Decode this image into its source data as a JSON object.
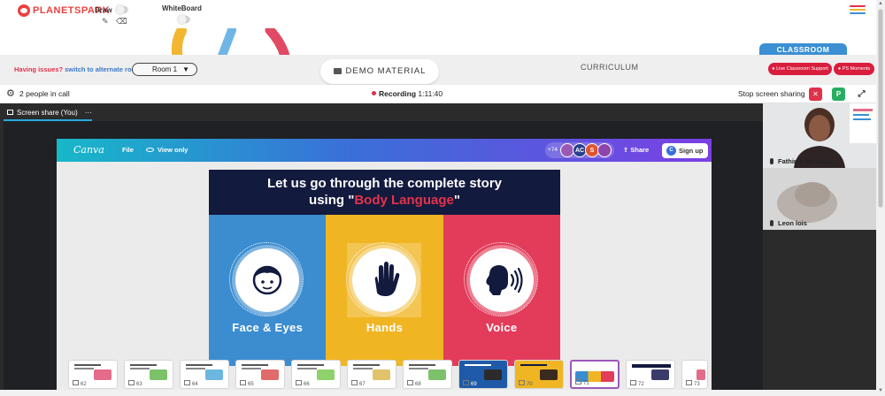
{
  "app": {
    "brand": "PLANETSPARK",
    "accent": "#e0314b",
    "blue": "#3b8fd3"
  },
  "topbar": {
    "draw_label": "Draw",
    "whiteboard_label": "WhiteBoard",
    "icons": [
      "pen-icon",
      "eraser-icon",
      "hamburger-icon"
    ]
  },
  "toolbar": {
    "issues_text": "Having issues?",
    "alternate_room_link": "switch to alternate room",
    "room_select": "Room 1",
    "demo_material": "DEMO MATERIAL",
    "curriculum": "CURRICULUM",
    "classroom_tab": "CLASSROOM",
    "live_support": "Live Classroom Support",
    "ps_moments": "PS Moments"
  },
  "callbar": {
    "people": "2 people in call",
    "recording_label": "Recording",
    "recording_time": "1:11:40",
    "stop_sharing": "Stop screen sharing",
    "p_badge": "P"
  },
  "share": {
    "tab_label": "Screen share (You)",
    "more": "···"
  },
  "canva": {
    "logo": "Canva",
    "file": "File",
    "view_only": "View only",
    "viewer_count": "+74",
    "avatars": [
      {
        "label": "",
        "color": "#9b59b6"
      },
      {
        "label": "AC",
        "color": "#2c3e8f"
      },
      {
        "label": "S",
        "color": "#e0532f"
      },
      {
        "label": "",
        "color": "#8e44ad"
      }
    ],
    "share": "Share",
    "signup": "Sign up"
  },
  "slide": {
    "title_line1": "Let us go through the complete story",
    "title_line2_prefix": "using ",
    "title_quote_open": "\"",
    "title_highlight": "Body Language",
    "title_quote_close": "\"",
    "panels": [
      {
        "caption": "Face & Eyes",
        "color": "#3b8dd0",
        "icon": "face-icon"
      },
      {
        "caption": "Hands",
        "color": "#f0b522",
        "icon": "hand-icon"
      },
      {
        "caption": "Voice",
        "color": "#e23c5a",
        "icon": "voice-icon"
      }
    ]
  },
  "thumbnails": [
    {
      "num": "62",
      "accent": "#e56b8a"
    },
    {
      "num": "63",
      "accent": "#7cc26b"
    },
    {
      "num": "64",
      "accent": "#6bb7e0"
    },
    {
      "num": "65",
      "accent": "#e06b6b"
    },
    {
      "num": "66",
      "accent": "#8fd16b"
    },
    {
      "num": "67",
      "accent": "#e0c36b"
    },
    {
      "num": "68",
      "accent": "#7cc26b"
    },
    {
      "num": "69",
      "accent": "#1f5aa8"
    },
    {
      "num": "70",
      "accent": "#f0b522"
    },
    {
      "num": "71",
      "accent": "#ffffff"
    },
    {
      "num": "72",
      "accent": "#3b3b6b"
    },
    {
      "num": "73",
      "accent": "#e56b8a"
    }
  ],
  "videos": [
    {
      "name": "Fathima Mr (You)"
    },
    {
      "name": "Leon lois"
    }
  ]
}
